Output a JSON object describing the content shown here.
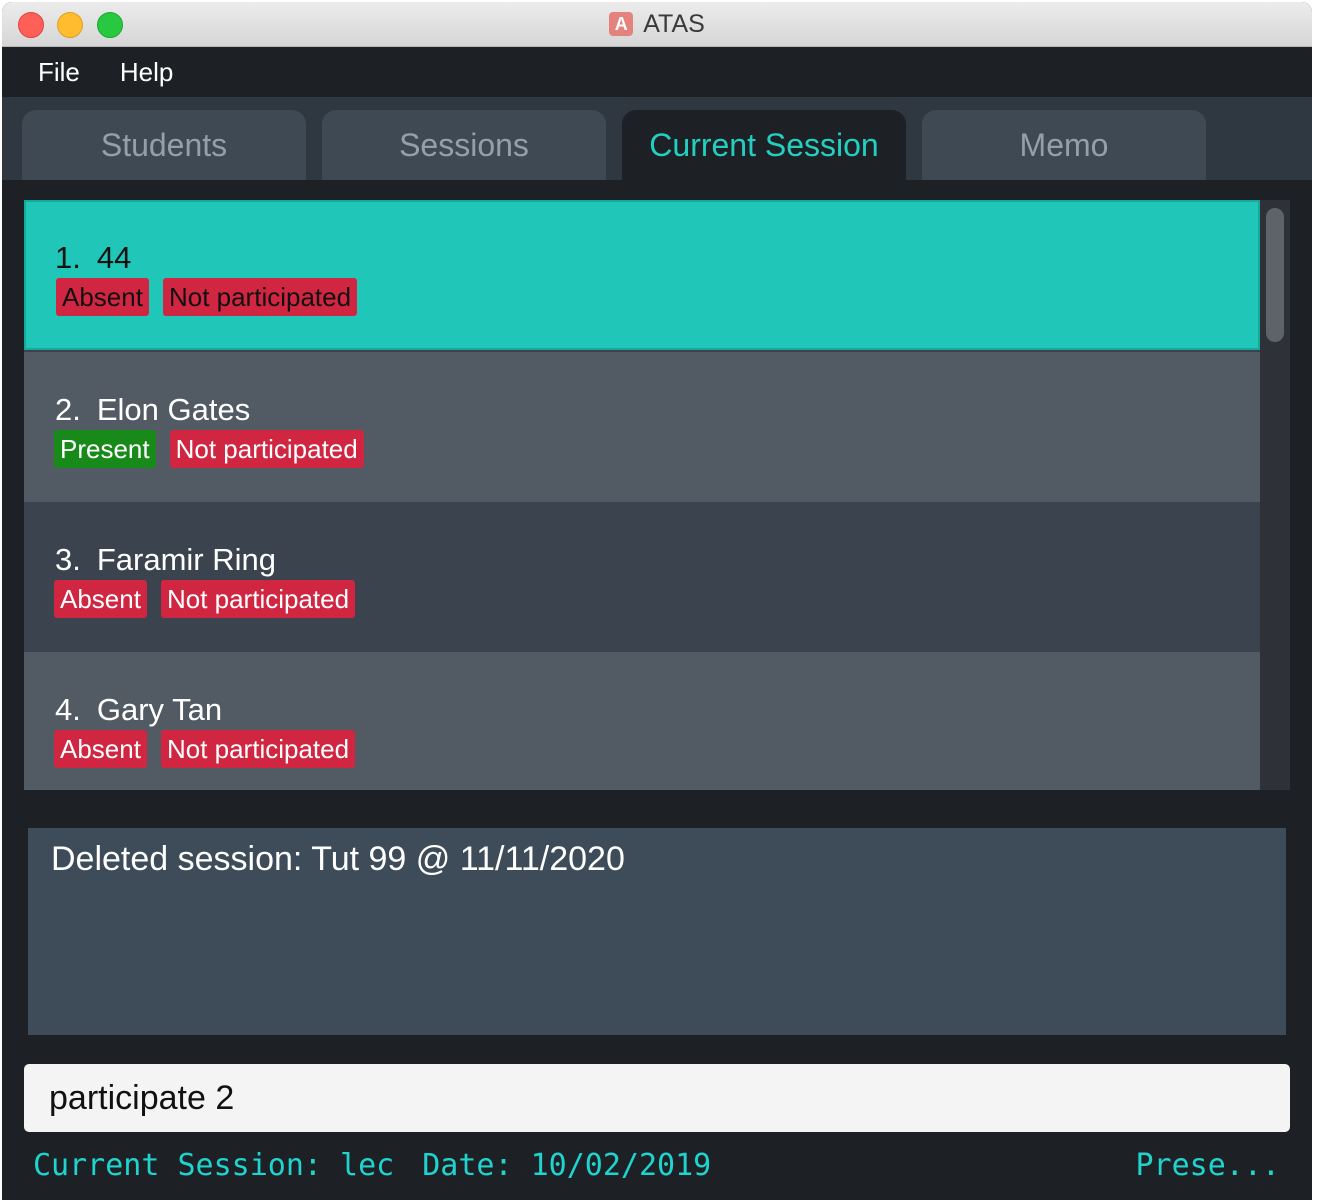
{
  "window": {
    "title": "ATAS",
    "app_icon_letter": "A"
  },
  "menu": [
    {
      "label": "File"
    },
    {
      "label": "Help"
    }
  ],
  "tabs": [
    {
      "label": "Students",
      "active": false
    },
    {
      "label": "Sessions",
      "active": false
    },
    {
      "label": "Current Session",
      "active": true
    },
    {
      "label": "Memo",
      "active": false
    }
  ],
  "attendance_list": [
    {
      "index": "1.",
      "name": "44",
      "attendance": "Absent",
      "participation": "Not participated",
      "selected": true
    },
    {
      "index": "2.",
      "name": "Elon Gates",
      "attendance": "Present",
      "participation": "Not participated",
      "selected": false
    },
    {
      "index": "3.",
      "name": "Faramir Ring",
      "attendance": "Absent",
      "participation": "Not participated",
      "selected": false
    },
    {
      "index": "4.",
      "name": "Gary Tan",
      "attendance": "Absent",
      "participation": "Not participated",
      "selected": false
    }
  ],
  "result_message": "Deleted session: Tut 99 @ 11/11/2020",
  "command_input": {
    "value": "participate 2"
  },
  "status_bar": {
    "current_session": "Current Session: lec",
    "date": "Date: 10/02/2019",
    "right_text": "Prese..."
  },
  "colors": {
    "accent": "#23cfc0",
    "selected_row": "#20c7b8",
    "absent_badge": "#d12641",
    "present_badge": "#178a1a",
    "background": "#1d2125"
  }
}
